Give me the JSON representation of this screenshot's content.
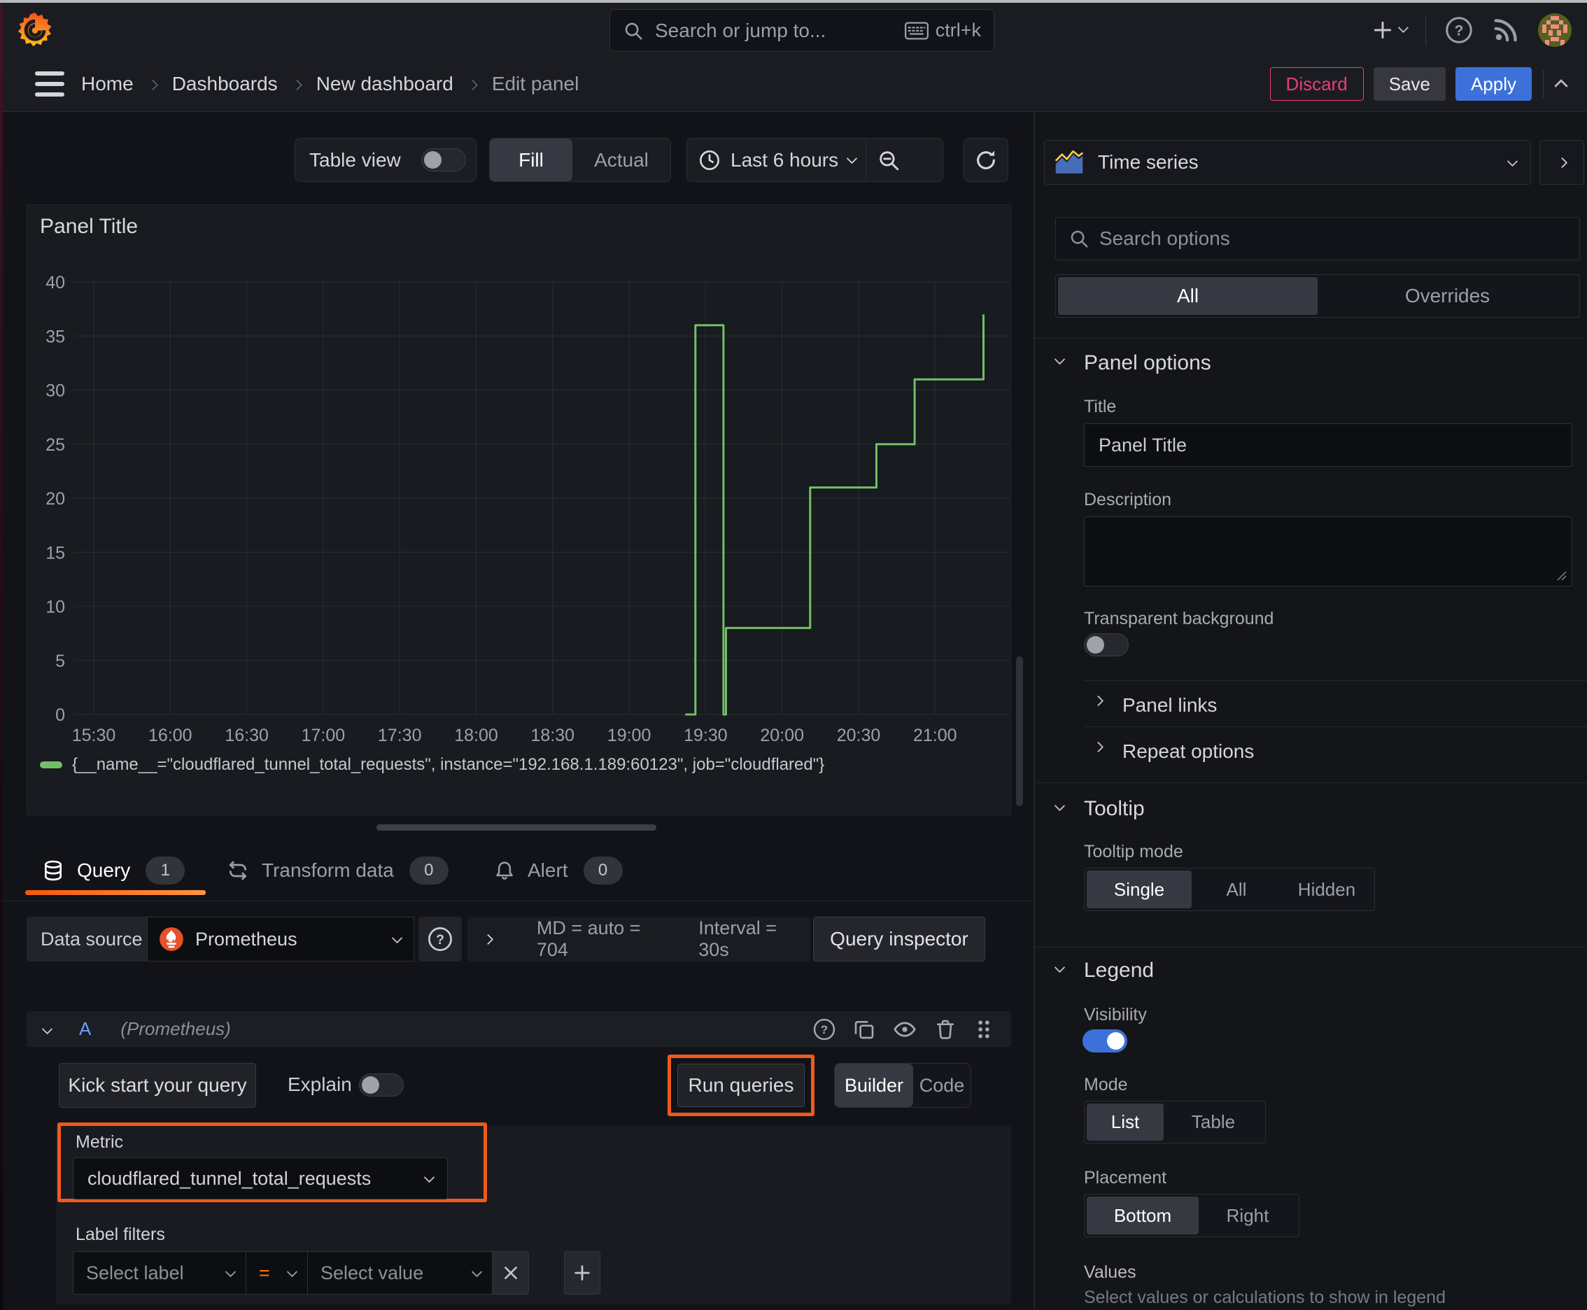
{
  "topnav": {
    "search_placeholder": "Search or jump to...",
    "search_shortcut": "ctrl+k"
  },
  "breadcrumbs": [
    "Home",
    "Dashboards",
    "New dashboard",
    "Edit panel"
  ],
  "actions": {
    "discard": "Discard",
    "save": "Save",
    "apply": "Apply"
  },
  "toolbar": {
    "table_view": "Table view",
    "fill": "Fill",
    "actual": "Actual",
    "time_range": "Last 6 hours"
  },
  "panel": {
    "title": "Panel Title",
    "legend": "{__name__=\"cloudflared_tunnel_total_requests\", instance=\"192.168.1.189:60123\", job=\"cloudflared\"}"
  },
  "chart_data": {
    "type": "line",
    "step": true,
    "title": "Panel Title",
    "x_axis": "time (minutes after 15:30)",
    "x_tick_labels": [
      "15:30",
      "16:00",
      "16:30",
      "17:00",
      "17:30",
      "18:00",
      "18:30",
      "19:00",
      "19:30",
      "20:00",
      "20:30",
      "21:00"
    ],
    "x_tick_minutes": [
      0,
      30,
      60,
      90,
      120,
      150,
      180,
      210,
      240,
      270,
      300,
      330
    ],
    "y_ticks": [
      0,
      5,
      10,
      15,
      20,
      25,
      30,
      35,
      40
    ],
    "ylim": [
      0,
      40
    ],
    "series": [
      {
        "name": "{__name__=\"cloudflared_tunnel_total_requests\", instance=\"192.168.1.189:60123\", job=\"cloudflared\"}",
        "color": "#73bf69",
        "points_min_value": [
          [
            232,
            0
          ],
          [
            236,
            36
          ],
          [
            247,
            0
          ],
          [
            248,
            8
          ],
          [
            281,
            21
          ],
          [
            307,
            25
          ],
          [
            322,
            31
          ],
          [
            349,
            37
          ]
        ]
      }
    ],
    "legend_position": "bottom",
    "grid": true
  },
  "tabs": {
    "query": {
      "label": "Query",
      "count": "1"
    },
    "transform": {
      "label": "Transform data",
      "count": "0"
    },
    "alert": {
      "label": "Alert",
      "count": "0"
    }
  },
  "datasource_row": {
    "label": "Data source",
    "name": "Prometheus",
    "stats_md": "MD = auto = 704",
    "stats_interval": "Interval = 30s",
    "inspector": "Query inspector"
  },
  "query_row": {
    "ref": "A",
    "datasource": "(Prometheus)"
  },
  "query_toolbar": {
    "kickstart": "Kick start your query",
    "explain": "Explain",
    "run": "Run queries",
    "builder": "Builder",
    "code": "Code"
  },
  "builder": {
    "metric_label": "Metric",
    "metric_value": "cloudflared_tunnel_total_requests",
    "label_filters": "Label filters",
    "select_label": "Select label",
    "operator": "=",
    "select_value": "Select value"
  },
  "annotations": {
    "color": "#ee5a1e"
  },
  "sidebar": {
    "visualization": "Time series",
    "search_placeholder": "Search options",
    "tab_all": "All",
    "tab_overrides": "Overrides",
    "panel_options": {
      "header": "Panel options",
      "title_label": "Title",
      "title_value": "Panel Title",
      "description_label": "Description",
      "transparent_label": "Transparent background"
    },
    "links": "Panel links",
    "repeat": "Repeat options",
    "tooltip": {
      "header": "Tooltip",
      "mode_label": "Tooltip mode",
      "options": [
        "Single",
        "All",
        "Hidden"
      ],
      "active": "Single"
    },
    "legend": {
      "header": "Legend",
      "visibility_label": "Visibility",
      "mode_label": "Mode",
      "modes": [
        "List",
        "Table"
      ],
      "active_mode": "List",
      "placement_label": "Placement",
      "placements": [
        "Bottom",
        "Right"
      ],
      "active_placement": "Bottom",
      "values_label": "Values",
      "values_help": "Select values or calculations to show in legend"
    }
  },
  "colors": {
    "page_bg": "#111217",
    "bar_bg": "#1b1c21",
    "panel_bg": "#181b1f",
    "accent_blue": "#3d71d9",
    "query_ref_blue": "#6e9fff",
    "series_green": "#73bf69",
    "brand_orange": "#ff780a",
    "annotation_orange": "#ee5a1e",
    "discard_pink": "#ef3b76"
  }
}
